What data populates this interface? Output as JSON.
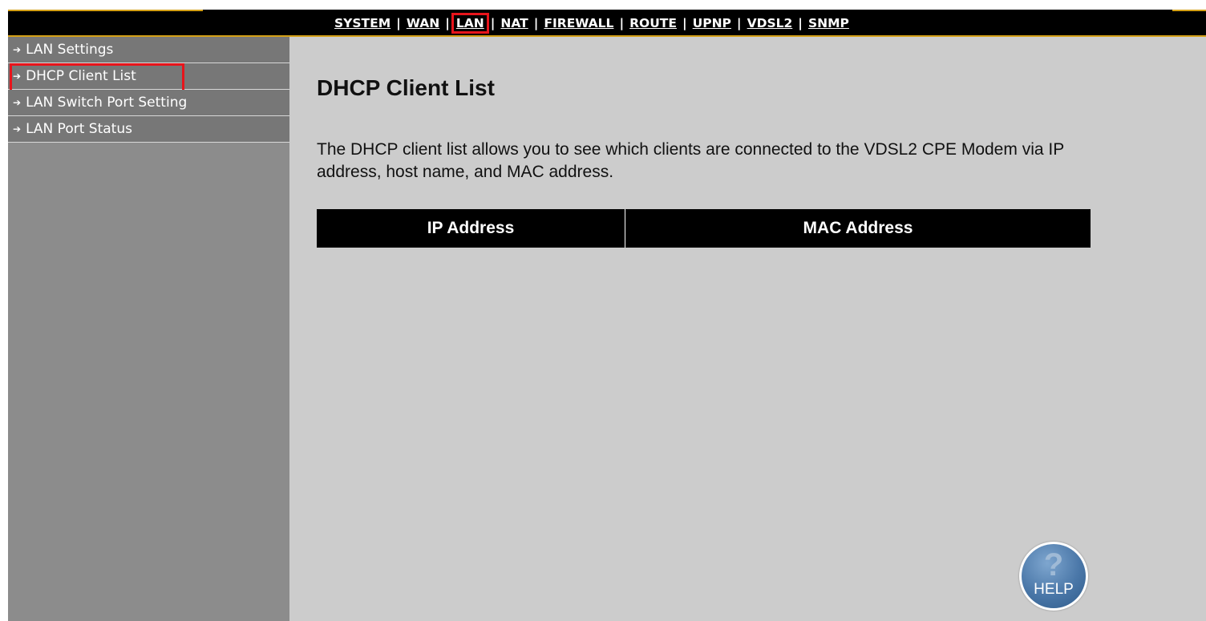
{
  "nav": {
    "items": [
      {
        "label": "SYSTEM"
      },
      {
        "label": "WAN"
      },
      {
        "label": "LAN"
      },
      {
        "label": "NAT"
      },
      {
        "label": "FIREWALL"
      },
      {
        "label": "ROUTE"
      },
      {
        "label": "UPNP"
      },
      {
        "label": "VDSL2"
      },
      {
        "label": "SNMP"
      }
    ],
    "separator": "|",
    "active": "LAN"
  },
  "sidebar": {
    "arrow_icon": "➔",
    "items": [
      {
        "label": "LAN Settings"
      },
      {
        "label": "DHCP Client List"
      },
      {
        "label": "LAN Switch Port Setting"
      },
      {
        "label": "LAN Port Status"
      }
    ],
    "active": "DHCP Client List"
  },
  "main": {
    "title": "DHCP Client List",
    "description_line1": "The DHCP client list allows you to see which clients are connected to the VDSL2 CPE Modem via IP",
    "description_line2": "address, host name, and MAC address.",
    "table": {
      "headers": [
        "IP Address",
        "MAC Address"
      ],
      "rows": []
    }
  },
  "help": {
    "icon": "question-mark",
    "label": "HELP"
  },
  "colors": {
    "topbar": "#000000",
    "accent": "#d4a017",
    "highlight": "#e8141b",
    "sidebar": "#8c8c8c",
    "content": "#cccccc"
  }
}
